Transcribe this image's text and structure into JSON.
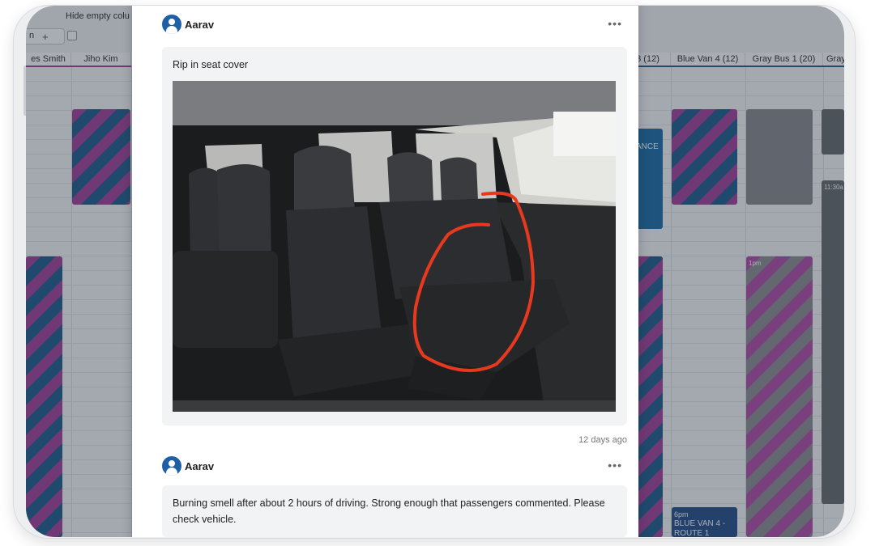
{
  "background_app": {
    "toolbar": {
      "hide_empty_label": "Hide empty colu",
      "search_value": "n",
      "add_symbol": "+"
    },
    "columns": [
      {
        "label": "es Smith"
      },
      {
        "label": "Jiho Kim"
      },
      {
        "label": "3 (12)"
      },
      {
        "label": "Blue Van 4 (12)"
      },
      {
        "label": "Gray Bus 1 (20)"
      },
      {
        "label": "Gray"
      }
    ],
    "blocks": [
      {
        "text": ""
      },
      {
        "text": ""
      },
      {
        "text": "ANCE"
      },
      {
        "text": ""
      },
      {
        "text": ""
      },
      {
        "text": "11:30a"
      },
      {
        "text": ""
      },
      {
        "text": "1pm"
      },
      {
        "text": ""
      },
      {
        "text": "6pm"
      },
      {
        "text": "BLUE VAN 4 -"
      },
      {
        "text": "ROUTE 1"
      }
    ],
    "colors": {
      "accent_purple": "#a3449b",
      "accent_blue": "#235f8e",
      "gray": "#8d8f93"
    }
  },
  "modal": {
    "posts": [
      {
        "author": "Aarav",
        "text": "Rip in seat cover",
        "attachment": "van-rear-seat-photo",
        "timestamp": "12 days ago"
      },
      {
        "author": "Aarav",
        "text": "Burning smell after about 2 hours of driving. Strong enough that passengers commented. Please check vehicle."
      }
    ],
    "more_icon": "more-horizontal-icon",
    "avatar_icon": "user-avatar-icon"
  }
}
